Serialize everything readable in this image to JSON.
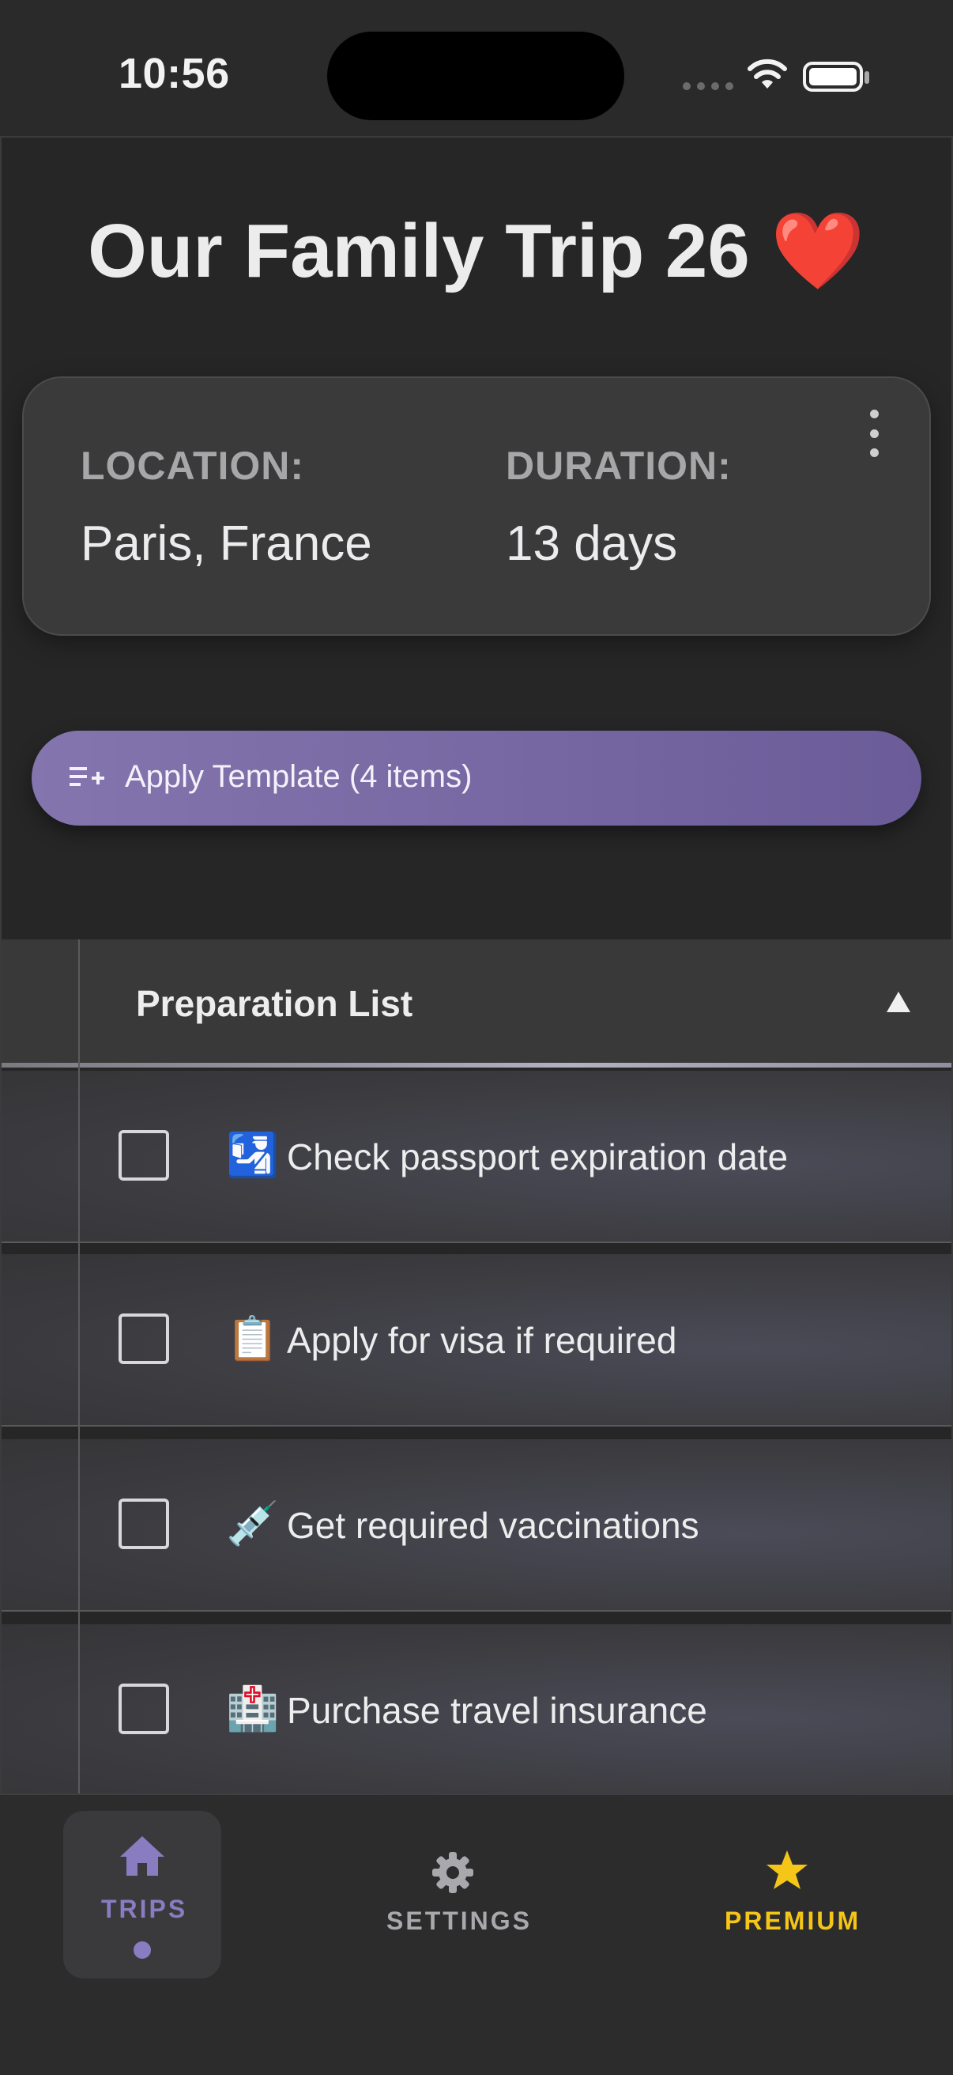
{
  "status_bar": {
    "time": "10:56"
  },
  "trip": {
    "title": "Our Family Trip 26 ❤️",
    "location_label": "LOCATION:",
    "location_value": "Paris, France",
    "duration_label": "DURATION:",
    "duration_value": "13 days"
  },
  "apply_template": {
    "label": "Apply Template (4 items)"
  },
  "preparation_list": {
    "title": "Preparation List",
    "items": [
      {
        "emoji": "🛂",
        "text": "Check passport expiration date",
        "checked": false
      },
      {
        "emoji": "📋",
        "text": "Apply for visa if required",
        "checked": false
      },
      {
        "emoji": "💉",
        "text": "Get required vaccinations",
        "checked": false
      },
      {
        "emoji": "🏥",
        "text": "Purchase travel insurance",
        "checked": false
      }
    ]
  },
  "tab_bar": {
    "tabs": [
      {
        "label": "TRIPS",
        "icon": "home-icon",
        "active": true
      },
      {
        "label": "SETTINGS",
        "icon": "gear-icon",
        "active": false
      },
      {
        "label": "PREMIUM",
        "icon": "star-icon",
        "active": false
      }
    ]
  },
  "colors": {
    "accent": "#8a7cc0",
    "premium": "#f5c518",
    "background": "#262627"
  }
}
